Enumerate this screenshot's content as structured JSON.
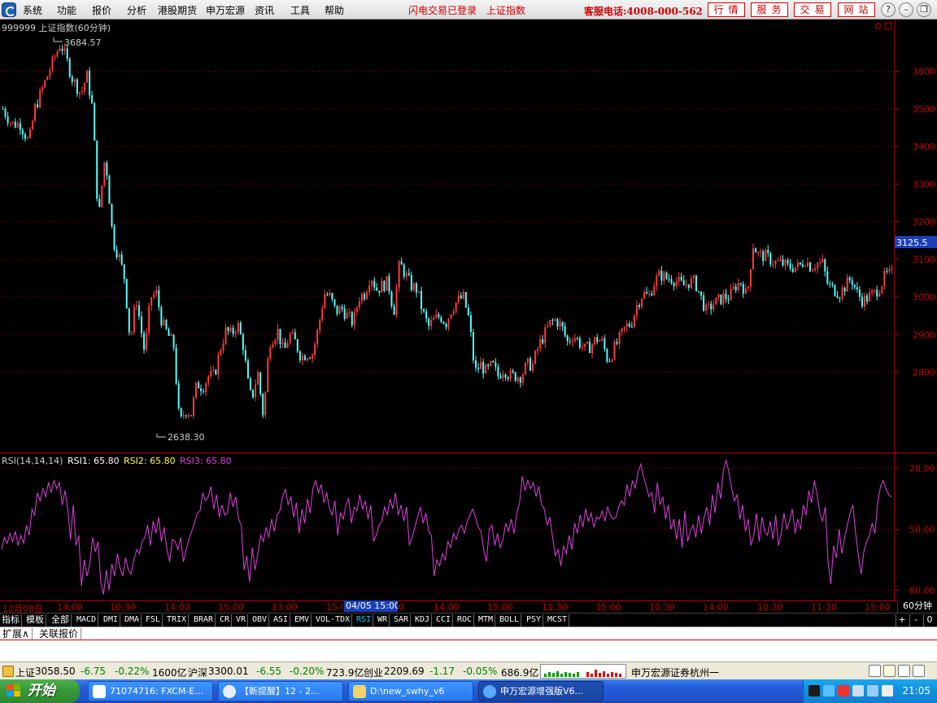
{
  "menu": {
    "items": [
      "系统",
      "功能",
      "报价",
      "分析",
      "港股期货",
      "申万宏源",
      "资讯",
      "工具",
      "帮助"
    ],
    "login_status": "闪电交易已登录",
    "index_name": "上证指数",
    "hotline": "客服电话:4008-000-562",
    "quick_buttons": [
      "行情",
      "服务",
      "交易",
      "网站"
    ],
    "window_controls": [
      "?",
      "–",
      "❐",
      "✕"
    ]
  },
  "main_chart": {
    "title": "999999 上证指数(60分钟)",
    "high_label": "3684.57",
    "low_label": "2638.30",
    "current_price": "3125.5",
    "y_ticks": [
      "3600",
      "3500",
      "3400",
      "3300",
      "3200",
      "3100",
      "3000",
      "2900",
      "2800"
    ],
    "icons": [
      "diamond-icon",
      "restore-icon"
    ]
  },
  "rsi": {
    "title": "RSI(14,14,14)",
    "rsi1_label": "RSI1: 65.80",
    "rsi2_label": "RSI2: 65.80",
    "rsi3_label": "RSI3: 65.80",
    "y_ticks": [
      "80.00",
      "50.00",
      "20.00"
    ]
  },
  "time_axis": {
    "ticks": [
      "12月08日",
      "14:00",
      "10:30",
      "14:00",
      "15:00",
      "13:00",
      "15:00",
      "0",
      "14:00",
      "15:00",
      "11:30",
      "15:00",
      "10:30",
      "14:00",
      "10:30",
      "11:30",
      "15:00"
    ],
    "cursor_time": "04/05 15:00",
    "period": "60分钟"
  },
  "indicator_tabs": {
    "items": [
      "指标",
      "模板",
      "全部",
      "MACD",
      "DMI",
      "DMA",
      "FSL",
      "TRIX",
      "BRAR",
      "CR",
      "VR",
      "OBV",
      "ASI",
      "EMV",
      "VOL-TDX",
      "RSI",
      "WR",
      "SAR",
      "KDJ",
      "CCI",
      "ROC",
      "MTM",
      "BOLL",
      "PSY",
      "MCST"
    ],
    "active": "RSI",
    "controls": [
      "+",
      "-",
      "0"
    ]
  },
  "expand_tabs": [
    "扩展∧",
    "关联报价"
  ],
  "status_bar": {
    "sh_label": "上证",
    "sh_value": "3058.50",
    "sh_change": "-6.75",
    "sh_pct": "-0.22%",
    "sh_amount": "1600亿",
    "hs_label": "沪深",
    "hs_value": "3300.01",
    "hs_change": "-6.55",
    "hs_pct": "-0.20%",
    "hs_amount": "723.9亿",
    "cy_label": "创业",
    "cy_value": "2209.69",
    "cy_change": "-1.17",
    "cy_pct": "-0.05%",
    "cy_amount": "686.9亿",
    "broker": "申万宏源证券杭州一"
  },
  "taskbar": {
    "start_label": "开始",
    "tasks": [
      "71074716: FXCM-E...",
      "【新提醒】12 - 2...",
      "D:\\new_swhy_v6",
      "申万宏源增强版V6..."
    ],
    "clock": "21:05"
  },
  "colors": {
    "up": "#ff3b3b",
    "down": "#54ffff",
    "grid": "#8b0000",
    "rsi_line": "#e040e0",
    "axis": "#c00000"
  },
  "chart_data": [
    {
      "type": "candlestick",
      "title": "999999 上证指数(60分钟)",
      "ylim": [
        2600,
        3720
      ],
      "y_ticks": [
        2800,
        2900,
        3000,
        3100,
        3200,
        3300,
        3400,
        3500,
        3600
      ],
      "annotations": {
        "high": 3684.57,
        "low": 2638.3,
        "last": 3125.5
      },
      "close_path": [
        [
          0,
          3500
        ],
        [
          3,
          3460
        ],
        [
          6,
          3460
        ],
        [
          9,
          3410
        ],
        [
          11,
          3500
        ],
        [
          14,
          3560
        ],
        [
          16,
          3600
        ],
        [
          18,
          3640
        ],
        [
          20,
          3675
        ],
        [
          22,
          3630
        ],
        [
          24,
          3580
        ],
        [
          27,
          3540
        ],
        [
          29,
          3590
        ],
        [
          31,
          3500
        ],
        [
          33,
          3200
        ],
        [
          35,
          3360
        ],
        [
          36,
          3330
        ],
        [
          38,
          3150
        ],
        [
          40,
          3110
        ],
        [
          42,
          3050
        ],
        [
          44,
          2880
        ],
        [
          46,
          3000
        ],
        [
          49,
          2850
        ],
        [
          51,
          3000
        ],
        [
          53,
          3010
        ],
        [
          55,
          2930
        ],
        [
          57,
          2900
        ],
        [
          59,
          2870
        ],
        [
          61,
          2660
        ],
        [
          63,
          2700
        ],
        [
          65,
          2690
        ],
        [
          67,
          2770
        ],
        [
          69,
          2760
        ],
        [
          71,
          2790
        ],
        [
          73,
          2790
        ],
        [
          75,
          2860
        ],
        [
          77,
          2910
        ],
        [
          79,
          2900
        ],
        [
          81,
          2930
        ],
        [
          83,
          2870
        ],
        [
          85,
          2750
        ],
        [
          86,
          2730
        ],
        [
          88,
          2800
        ],
        [
          90,
          2680
        ],
        [
          92,
          2880
        ],
        [
          95,
          2910
        ],
        [
          97,
          2850
        ],
        [
          99,
          2900
        ],
        [
          101,
          2880
        ],
        [
          103,
          2840
        ],
        [
          105,
          2850
        ],
        [
          107,
          2850
        ],
        [
          109,
          2920
        ],
        [
          111,
          3010
        ],
        [
          113,
          3000
        ],
        [
          115,
          2960
        ],
        [
          117,
          2970
        ],
        [
          119,
          2950
        ],
        [
          121,
          2930
        ],
        [
          123,
          3000
        ],
        [
          125,
          3010
        ],
        [
          127,
          3060
        ],
        [
          129,
          3020
        ],
        [
          131,
          3030
        ],
        [
          133,
          3040
        ],
        [
          135,
          2960
        ],
        [
          137,
          3090
        ],
        [
          139,
          3060
        ],
        [
          141,
          3030
        ],
        [
          143,
          3020
        ],
        [
          145,
          2960
        ],
        [
          147,
          2920
        ],
        [
          149,
          2940
        ],
        [
          151,
          2950
        ],
        [
          153,
          2930
        ],
        [
          155,
          2970
        ],
        [
          157,
          2990
        ],
        [
          159,
          3000
        ],
        [
          161,
          2940
        ],
        [
          163,
          2800
        ],
        [
          165,
          2820
        ],
        [
          167,
          2800
        ],
        [
          169,
          2820
        ],
        [
          171,
          2790
        ],
        [
          173,
          2810
        ],
        [
          175,
          2790
        ],
        [
          177,
          2790
        ],
        [
          179,
          2790
        ],
        [
          181,
          2820
        ],
        [
          183,
          2820
        ],
        [
          185,
          2870
        ],
        [
          187,
          2900
        ],
        [
          189,
          2930
        ],
        [
          191,
          2940
        ],
        [
          193,
          2920
        ],
        [
          195,
          2880
        ],
        [
          197,
          2900
        ],
        [
          199,
          2880
        ],
        [
          201,
          2860
        ],
        [
          203,
          2870
        ],
        [
          205,
          2890
        ],
        [
          207,
          2880
        ],
        [
          209,
          2830
        ],
        [
          211,
          2860
        ],
        [
          213,
          2890
        ],
        [
          215,
          2920
        ],
        [
          217,
          2930
        ],
        [
          219,
          2980
        ],
        [
          221,
          3010
        ],
        [
          223,
          3000
        ],
        [
          225,
          3040
        ],
        [
          227,
          3060
        ],
        [
          229,
          3050
        ],
        [
          231,
          3050
        ],
        [
          233,
          3040
        ],
        [
          235,
          3030
        ],
        [
          237,
          3040
        ],
        [
          239,
          3040
        ],
        [
          241,
          3000
        ],
        [
          243,
          2960
        ],
        [
          245,
          2980
        ],
        [
          247,
          2990
        ],
        [
          249,
          3000
        ],
        [
          251,
          3000
        ],
        [
          253,
          3030
        ],
        [
          255,
          3040
        ],
        [
          257,
          3000
        ],
        [
          259,
          3140
        ],
        [
          261,
          3110
        ],
        [
          263,
          3110
        ],
        [
          265,
          3100
        ],
        [
          267,
          3090
        ],
        [
          269,
          3090
        ],
        [
          271,
          3080
        ],
        [
          273,
          3080
        ],
        [
          275,
          3080
        ],
        [
          277,
          3100
        ],
        [
          279,
          3080
        ],
        [
          281,
          3090
        ],
        [
          283,
          3090
        ],
        [
          285,
          3030
        ],
        [
          287,
          3020
        ],
        [
          289,
          3010
        ],
        [
          291,
          3030
        ],
        [
          293,
          3050
        ],
        [
          295,
          3010
        ],
        [
          297,
          2990
        ],
        [
          299,
          3000
        ],
        [
          301,
          3010
        ],
        [
          303,
          3030
        ],
        [
          305,
          3060
        ],
        [
          307,
          3060
        ]
      ]
    },
    {
      "type": "line",
      "title": "RSI(14,14,14)",
      "ylim": [
        15,
        87
      ],
      "y_ticks": [
        20,
        50,
        80
      ],
      "series": [
        {
          "name": "RSI1",
          "last": 65.8
        },
        {
          "name": "RSI2",
          "last": 65.8
        },
        {
          "name": "RSI3",
          "last": 65.8
        }
      ],
      "values": [
        40,
        46,
        43,
        48,
        44,
        49,
        42,
        47,
        43,
        52,
        47,
        60,
        57,
        68,
        64,
        70,
        66,
        73,
        68,
        74,
        70,
        73,
        62,
        69,
        60,
        45,
        62,
        42,
        47,
        22,
        35,
        27,
        33,
        46,
        39,
        44,
        24,
        18,
        30,
        20,
        33,
        27,
        38,
        31,
        27,
        36,
        30,
        28,
        35,
        40,
        38,
        44,
        46,
        52,
        42,
        54,
        48,
        56,
        44,
        51,
        40,
        34,
        45,
        44,
        40,
        46,
        34,
        40,
        45,
        49,
        53,
        58,
        59,
        68,
        64,
        66,
        71,
        60,
        67,
        56,
        62,
        57,
        58,
        68,
        61,
        66,
        55,
        52,
        30,
        37,
        24,
        41,
        30,
        38,
        47,
        44,
        51,
        46,
        55,
        49,
        57,
        59,
        66,
        70,
        62,
        66,
        56,
        63,
        48,
        60,
        53,
        65,
        58,
        70,
        74,
        68,
        72,
        63,
        68,
        60,
        57,
        64,
        47,
        58,
        55,
        62,
        65,
        53,
        61,
        59,
        67,
        60,
        64,
        55,
        62,
        44,
        47,
        52,
        54,
        61,
        57,
        65,
        60,
        68,
        57,
        62,
        54,
        61,
        42,
        46,
        51,
        56,
        61,
        53,
        58,
        49,
        47,
        27,
        35,
        32,
        38,
        35,
        44,
        41,
        48,
        45,
        50,
        52,
        48,
        54,
        57,
        60,
        56,
        51,
        49,
        40,
        34,
        50,
        52,
        42,
        48,
        41,
        45,
        53,
        49,
        55,
        48,
        58,
        63,
        76,
        69,
        74,
        70,
        73,
        66,
        71,
        62,
        60,
        52,
        56,
        46,
        37,
        40,
        32,
        42,
        38,
        47,
        40,
        53,
        48,
        57,
        51,
        60,
        54,
        58,
        51,
        56,
        55,
        59,
        54,
        61,
        57,
        55,
        56,
        61,
        64,
        62,
        72,
        66,
        74,
        70,
        78,
        82,
        76,
        71,
        66,
        68,
        58,
        73,
        62,
        66,
        55,
        62,
        50,
        55,
        45,
        55,
        41,
        59,
        44,
        49,
        52,
        46,
        57,
        48,
        56,
        61,
        52,
        67,
        58,
        73,
        65,
        79,
        84,
        78,
        70,
        64,
        67,
        55,
        62,
        49,
        55,
        42,
        47,
        58,
        44,
        56,
        49,
        47,
        54,
        45,
        57,
        42,
        48,
        58,
        50,
        54,
        60,
        48,
        55,
        50,
        62,
        57,
        69,
        63,
        74,
        67,
        58,
        54,
        61,
        34,
        23,
        42,
        36,
        50,
        38,
        46,
        52,
        58,
        62,
        48,
        37,
        28,
        39,
        44,
        47,
        53,
        48,
        63,
        71,
        74,
        70,
        67,
        65.8
      ]
    }
  ]
}
